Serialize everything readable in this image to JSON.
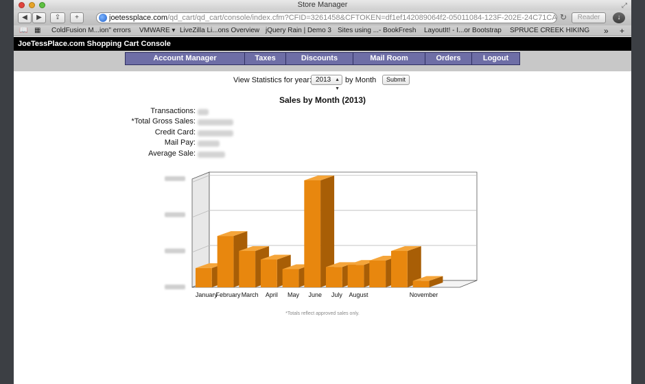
{
  "window": {
    "title": "Store Manager"
  },
  "toolbar": {
    "back_icon": "◀",
    "forward_icon": "▶",
    "share_icon": "⇪",
    "add_icon": "+",
    "url_host": "joetessplace.com",
    "url_path": "/qd_cart/qd_cart/console/index.cfm?CFID=3261458&CFTOKEN=df1ef142089064f2-05011084-123F-202E-24C71CA75285C137",
    "reload_icon": "↻",
    "reader_label": "Reader",
    "download_icon": "↓"
  },
  "bookmarks": {
    "items": [
      "ColdFusion M...ion\" errors",
      "VMWARE ▾",
      "LiveZilla Li...ons Overview",
      "jQuery Rain | Demo 3",
      "Sites using ...- BookFresh",
      "LayoutIt! - I...or Bootstrap",
      "SPRUCE CREEK HIKING"
    ],
    "overflow_icon": "»",
    "add_icon": "+"
  },
  "site": {
    "header": "JoeTessPlace.com Shopping Cart Console",
    "nav": [
      "Account Manager",
      "Taxes",
      "Discounts",
      "Mail Room",
      "Orders",
      "Logout"
    ]
  },
  "stats_form": {
    "label": "View Statistics for year:",
    "year": "2013",
    "by_month": "by Month",
    "submit": "Submit"
  },
  "summary": {
    "title": "Sales by Month (2013)",
    "labels": [
      "Transactions:",
      "*Total Gross Sales:",
      "Credit Card:",
      "Mail Pay:",
      "Average Sale:"
    ]
  },
  "chart_data": {
    "type": "bar",
    "categories": [
      "January",
      "February",
      "March",
      "April",
      "May",
      "June",
      "July",
      "August",
      "",
      "",
      "November",
      ""
    ],
    "values": [
      0.18,
      0.48,
      0.34,
      0.26,
      0.17,
      1.0,
      0.19,
      0.21,
      0.25,
      0.34,
      0.06
    ],
    "value_scale": "relative to the tallest bar (June); axis values are blurred",
    "bar_color": "#e8870e",
    "grid": true,
    "yticks_blurred": 4
  },
  "footnote": "*Totals reflect approved sales only.",
  "colors": {
    "nav_bg": "#6e6ea6",
    "header_bg": "#000000",
    "bar": "#e8870e",
    "bar_side": "#a85e06",
    "bar_top": "#f5a53a"
  }
}
